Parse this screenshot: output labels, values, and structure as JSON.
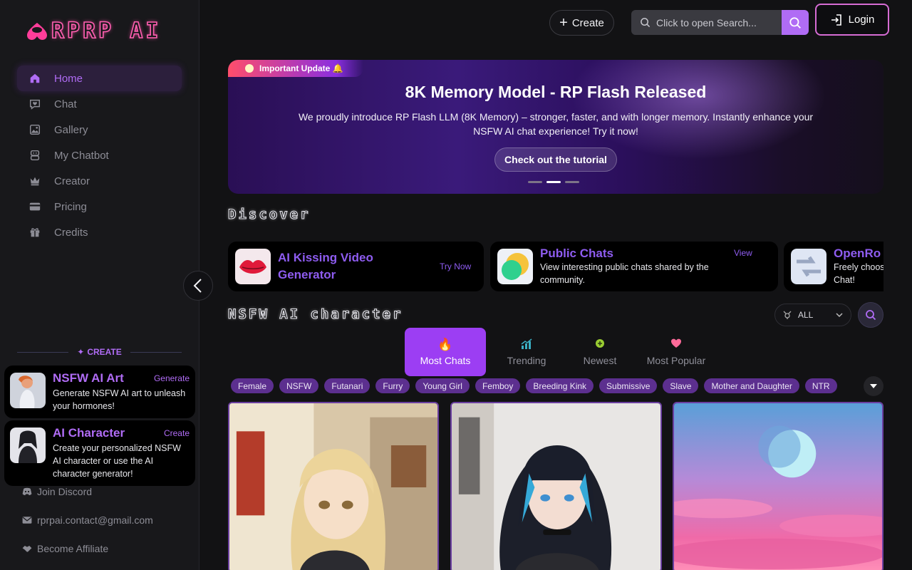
{
  "logo": {
    "text": "RPRP AI"
  },
  "sidebar": {
    "nav": [
      {
        "label": "Home",
        "icon": "home-icon",
        "active": true
      },
      {
        "label": "Chat",
        "icon": "chat-icon"
      },
      {
        "label": "Gallery",
        "icon": "gallery-icon"
      },
      {
        "label": "My Chatbot",
        "icon": "robot-icon"
      },
      {
        "label": "Creator",
        "icon": "crown-icon"
      },
      {
        "label": "Pricing",
        "icon": "card-icon"
      },
      {
        "label": "Credits",
        "icon": "gift-icon"
      }
    ],
    "create_label": "CREATE",
    "promos": [
      {
        "title": "NSFW AI Art",
        "action": "Generate",
        "desc": "Generate NSFW AI art to unleash your hormones!"
      },
      {
        "title": "AI Character",
        "action": "Create",
        "desc": "Create your personalized NSFW AI character or use the AI character generator!"
      }
    ],
    "footer": [
      {
        "label": "Join Discord",
        "icon": "discord-icon"
      },
      {
        "label": "rprpai.contact@gmail.com",
        "icon": "mail-icon"
      },
      {
        "label": "Become Affiliate",
        "icon": "handshake-icon"
      }
    ]
  },
  "header": {
    "create_label": "Create",
    "search_placeholder": "Click to open Search...",
    "login_label": "Login"
  },
  "banner": {
    "badge": "Important Update 🔔",
    "title": "8K Memory Model - RP Flash Released",
    "desc": "We proudly introduce RP Flash LLM (8K Memory) – stronger, faster, and with longer memory. Instantly enhance your NSFW AI chat experience! Try it now!",
    "button": "Check out the tutorial",
    "slide_count": 3,
    "active_slide": 2
  },
  "discover": {
    "title": "Discover",
    "cards": [
      {
        "title": "AI Kissing Video Generator",
        "desc": "",
        "action": "Try Now"
      },
      {
        "title": "Public Chats",
        "desc": "View interesting public chats shared by the community.",
        "action": "View"
      },
      {
        "title": "OpenRo",
        "desc": "Freely choos Chat!",
        "action": ""
      }
    ]
  },
  "characters": {
    "title": "NSFW AI character",
    "filter_value": "ALL",
    "tabs": [
      {
        "label": "Most Chats",
        "icon": "🔥",
        "active": true
      },
      {
        "label": "Trending",
        "icon": "📈"
      },
      {
        "label": "Newest",
        "icon": "🟢"
      },
      {
        "label": "Most Popular",
        "icon": "💗"
      }
    ],
    "tags": [
      "Female",
      "NSFW",
      "Futanari",
      "Furry",
      "Young Girl",
      "Femboy",
      "Breeding Kink",
      "Submissive",
      "Slave",
      "Mother and Daughter",
      "NTR"
    ]
  },
  "colors": {
    "accent": "#b06cf5",
    "accent_strong": "#9c3ef3",
    "tag_bg": "#5c2f8f",
    "logo_pink": "#ff5fb0"
  }
}
